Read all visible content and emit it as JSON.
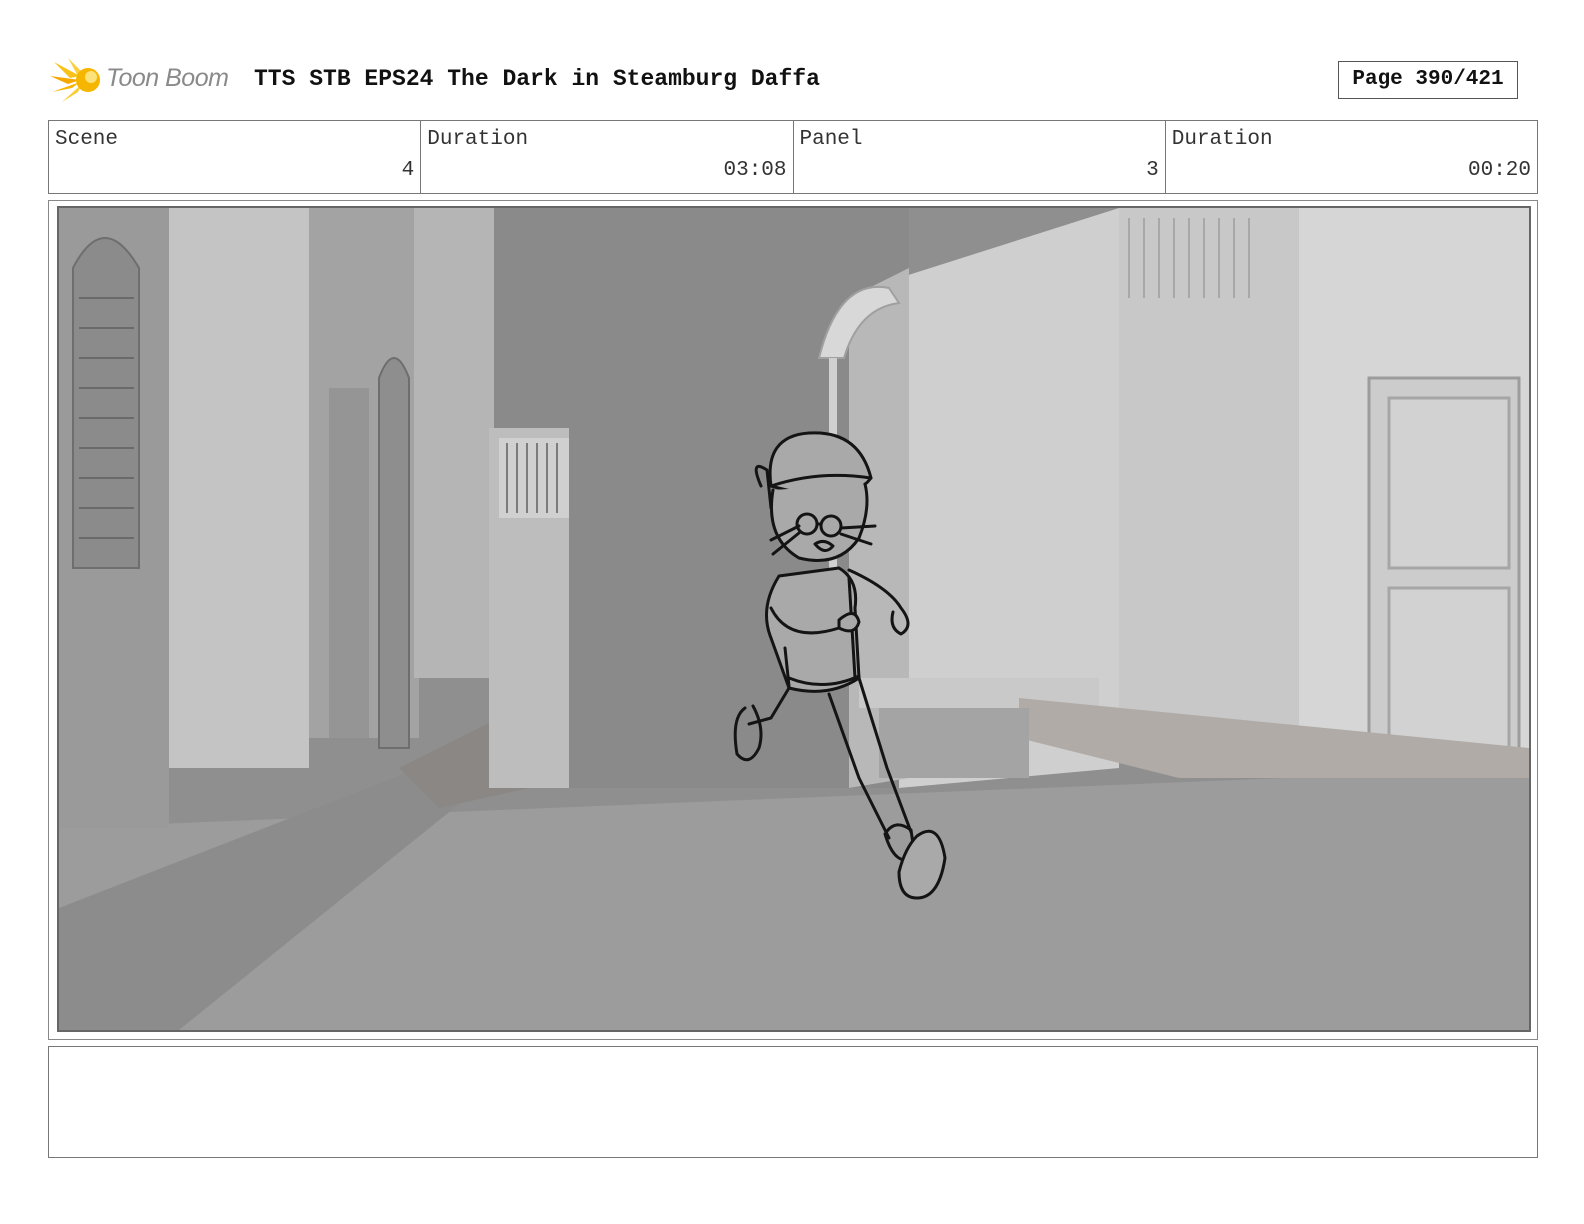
{
  "header": {
    "logo_text": "Toon Boom",
    "title": "TTS STB EPS24 The Dark in Steamburg Daffa",
    "page": "Page 390/421"
  },
  "info": {
    "scene_label": "Scene",
    "scene_value": "4",
    "scene_duration_label": "Duration",
    "scene_duration_value": "03:08",
    "panel_label": "Panel",
    "panel_value": "3",
    "panel_duration_label": "Duration",
    "panel_duration_value": "00:20"
  },
  "notes": {
    "text": ""
  },
  "colors": {
    "logo_accent": "#f5b800",
    "border": "#777777",
    "background_render": "#9a9a9a"
  }
}
